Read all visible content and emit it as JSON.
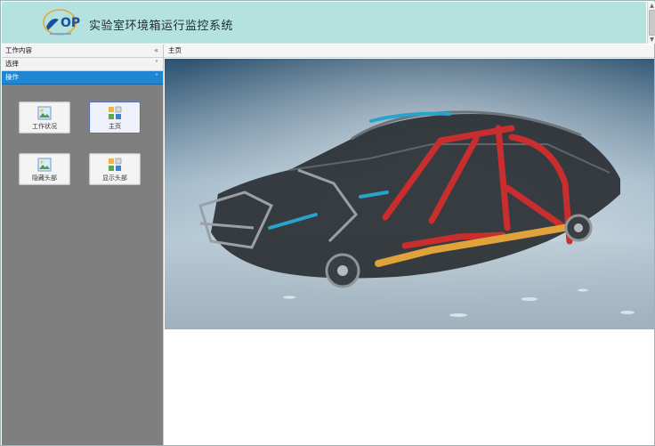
{
  "header": {
    "title": "实验室环境箱运行监控系统",
    "logo_text": "OP",
    "logo_icon": "op-logo-icon"
  },
  "left_panel": {
    "sections": [
      {
        "label": "工作内容",
        "chevron": "«"
      },
      {
        "label": "选择",
        "chevron": "˅"
      },
      {
        "label": "操作",
        "chevron": "˄"
      }
    ],
    "tiles": [
      {
        "label": "工作状况",
        "icon": "image-icon",
        "active": false
      },
      {
        "label": "主页",
        "icon": "home-grid-icon",
        "active": true
      },
      {
        "label": "隐藏头部",
        "icon": "image-icon",
        "active": false
      },
      {
        "label": "显示头部",
        "icon": "home-grid-icon",
        "active": false
      }
    ]
  },
  "content": {
    "tab_label": "主页",
    "hero_icon": "car-body-frame-illustration"
  },
  "colors": {
    "header_bg": "#b4e2df",
    "left_bg": "#7f7f7f",
    "active_section": "#1f86d2",
    "frame_red": "#c82e2e",
    "frame_yellow": "#e0a23a",
    "frame_cyan": "#2aa3c8"
  }
}
